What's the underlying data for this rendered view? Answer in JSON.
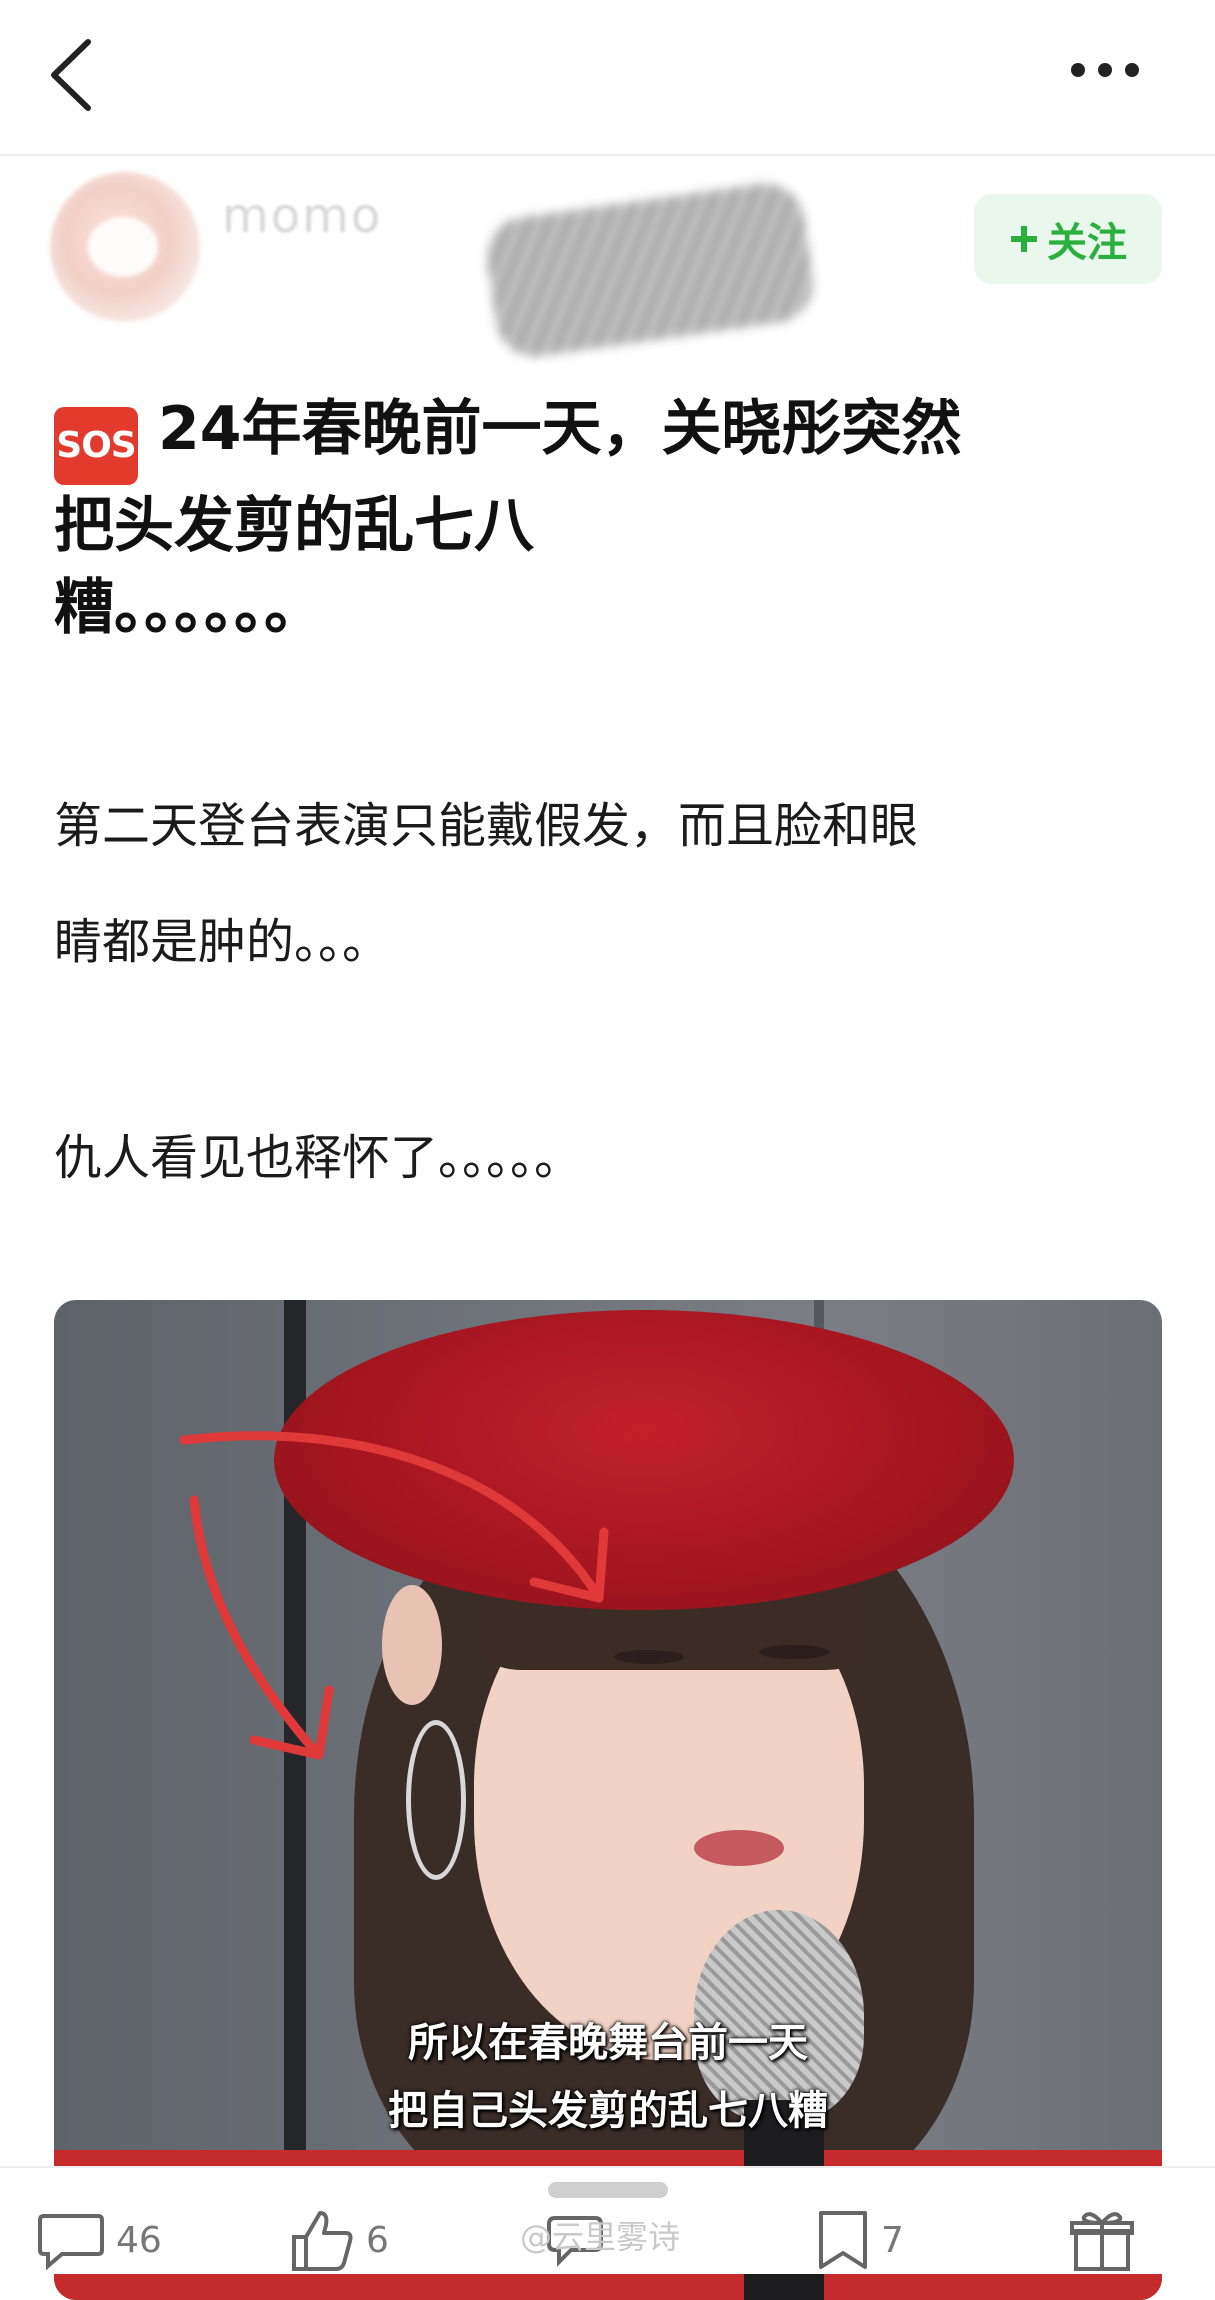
{
  "header": {
    "back_icon": "chevron-left-icon",
    "more_icon": "more-dots-icon"
  },
  "author": {
    "name": "momo",
    "tag": "",
    "meta": "",
    "follow_label": "关注",
    "follow_icon": "plus-icon",
    "accent_color": "#2bb03f"
  },
  "post": {
    "sos_badge": "SOS",
    "title_lines": [
      "24年春晚前一天，关晓彤突然",
      "把头发剪的乱七八",
      "糟。。。。。。"
    ],
    "paragraph1_lines": [
      "第二天登台表演只能戴假发，而且脸和眼",
      "睛都是肿的。。。"
    ],
    "paragraph2": "仇人看见也释怀了。。。。。"
  },
  "image": {
    "caption_line1": "所以在春晚舞台前一天",
    "caption_line2": "把自己头发剪的乱七八糟"
  },
  "bottom_bar": {
    "comments_count": "46",
    "likes_count": "6",
    "favorites_count": "7",
    "watermark": "@云里雾诗"
  }
}
